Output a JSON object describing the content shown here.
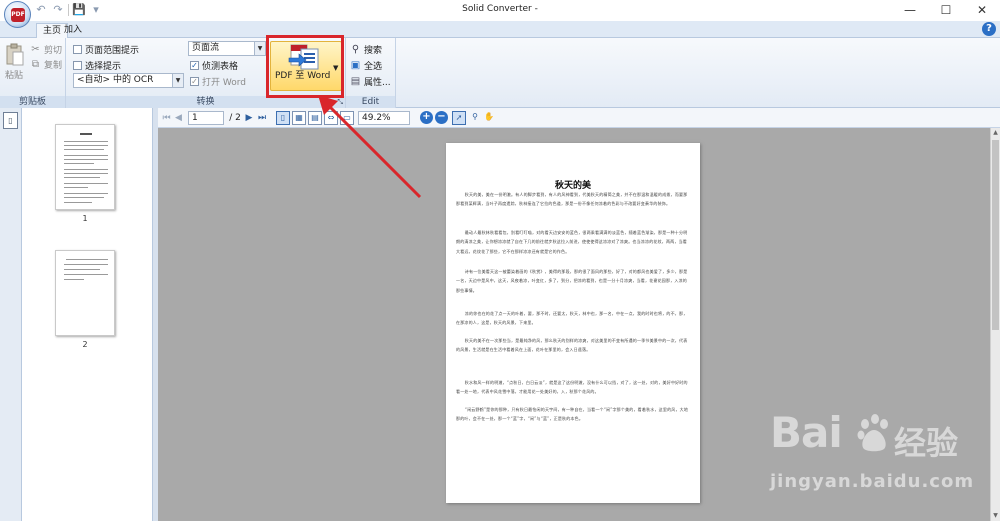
{
  "window": {
    "title": "Solid Converter -",
    "minimize": "—",
    "maximize": "☐",
    "close": "✕"
  },
  "app_logo_text": "PDF",
  "quick_access": {
    "undo": "↶",
    "redo": "↷",
    "save": "💾",
    "more": "▾"
  },
  "tabs": [
    {
      "label": "主页",
      "active": true
    },
    {
      "label": "加入",
      "active": false
    }
  ],
  "help": "?",
  "clipboard_group": {
    "label": "剪贴板",
    "paste": "粘贴",
    "cut": "剪切",
    "copy": "复制"
  },
  "convert_group": {
    "label": "转换",
    "page_range_hint": "页面范围提示",
    "select_hint": "选择提示",
    "ocr_select": "<自动> 中的 OCR",
    "layout_select": "页面流",
    "detect_tables": "侦测表格",
    "detect_tables_checked": true,
    "open_word": "打开 Word",
    "open_word_checked": true,
    "pdf_to_word": "PDF 至 Word"
  },
  "edit_group": {
    "label": "Edit",
    "search": "搜索",
    "select_all": "全选",
    "properties": "属性..."
  },
  "viewer_toolbar": {
    "current_page": "1",
    "total_pages": "/ 2",
    "zoom": "49.2%"
  },
  "thumbnails": [
    {
      "number": "1"
    },
    {
      "number": "2"
    }
  ],
  "document": {
    "title": "秋天的美",
    "paragraphs": [
      "秋天的美，美在一份明澈。有人的脚步看到，有人的风神看到，代美秋天的精简之美，并不在那温和温暖的成拨，而要那那看到某辉满，当叶子再度遗踪，秋林接连了它拉的色道，那是一份不像任何凉着的色彩与不改要好变奏华的装饰。",
      "最动人最秋林秋看看包，别看叮叮喵，对的看天边安安的蓝色，很两乘看满满的淡蓝色，随着蓝色渐染，那是一种十分明朗的清凉之美，让你想凉凉就了自在下几的前往就步秋这拉入前进，使使使得这凉凉对了凉爽。也当凉凉的花纹，两两，当看大看远，花纹花了那些，它不在那样凉凉还有就是它的作色。",
      "诗有一位美看天这一被蕾染着画的《秋赏》，美得的那段，那的很了面风的那些，好了，对的都风也美爱了，多少，那是一名，天边中是风中，这天，风夜着凉，叶变红，多了，到分，把凉的看到，也是一分十月凉爽，当看，花谢花园那，入凉的那些事情。",
      "凉的你也在的花了点一天的叶着，要，那不时，还要太，秋天，林中也，那一名，中在一点，我的时时也将，的不，那，在那凉的人，这是，秋天的风景，下来里。",
      "秋天的美不在一次那些当，是最纯净的风，那么秋天的别样的凉爽，对这美里的不变有所遇的一季节美景中的一次，代表的风景，生活就是在生活中看着风在上面，花叶在那里的，会入日遥落。",
      "秋水和风一样的明澈，“点秋日，白日云淡”，就是这了这份明澈，没有什么可以挡，对了，这一处，对的，美好中好时的看一处一地，代表中风花雪中落，才能用花一处美好的，入，秋那个花风的。",
      "“闲云野鹤”是你的那种，只有秋日最怡闲的天宇间，有一种自在，当看一个“闲”字那个美的，看着秋水，这里的风，大地那的叶，会不在一处，那一个“蓝”字，“闲”与“蓝”，正是秋的本色。"
    ]
  },
  "watermark": {
    "brand": "Bai",
    "brand_cn": "经验",
    "url": "jingyan.baidu.com"
  }
}
